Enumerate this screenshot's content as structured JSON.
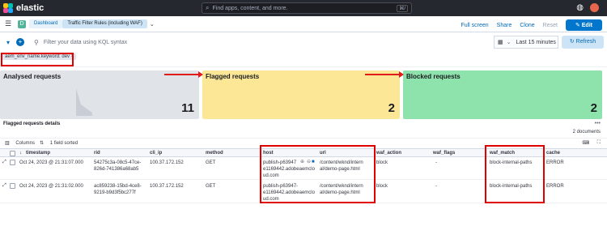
{
  "header": {
    "brand": "elastic",
    "search_placeholder": "Find apps, content, and more.",
    "search_shortcut": "⌘/"
  },
  "appbar": {
    "space_badge": "D",
    "breadcrumbs": [
      "Dashboard",
      "Traffic Filter Rules (including WAF)"
    ],
    "actions": [
      "Full screen",
      "Share",
      "Clone",
      "Reset"
    ],
    "edit_label": "Edit"
  },
  "querybar": {
    "placeholder": "Filter your data using KQL syntax",
    "time_range": "Last 15 minutes",
    "refresh_label": "Refresh"
  },
  "filter_pill": "aem_env_name.keyword: dev",
  "metrics": [
    {
      "title": "Analysed requests",
      "value": "11",
      "color": "#e0e3e8"
    },
    {
      "title": "Flagged requests",
      "value": "2",
      "color": "#fbe795"
    },
    {
      "title": "Blocked requests",
      "value": "2",
      "color": "#8ee3ac"
    }
  ],
  "table": {
    "title": "Flagged requests details",
    "doc_count": "2 documents",
    "columns_label": "Columns",
    "sort_label": "1 field sorted",
    "headers": [
      "timestamp",
      "rid",
      "cli_ip",
      "method",
      "host",
      "url",
      "waf_action",
      "waf_flags",
      "waf_match",
      "cache"
    ],
    "rows": [
      {
        "timestamp": "Oct 24, 2023 @ 21:31:07.000",
        "rid_1": "54275c3a-08c5-47ce-",
        "rid_2": "826d-741386a68ab5",
        "cli_ip": "100.37.172.152",
        "method": "GET",
        "host_1": "publish-p63947",
        "host_2": "e1169442.adobeaemclo",
        "host_3": "ud.com",
        "url_1": "/content/wknd/intern",
        "url_2": "al/demo-page.html",
        "waf_action": "block",
        "waf_flags": "-",
        "waf_match": "block-internal-paths",
        "cache": "ERROR"
      },
      {
        "timestamp": "Oct 24, 2023 @ 21:31:02.000",
        "rid_1": "ac859238-15bd-4ce8-",
        "rid_2": "9219-b9d3f5bc277f",
        "cli_ip": "100.37.172.152",
        "method": "GET",
        "host_1": "publish-p63947-",
        "host_2": "e1169442.adobeaemclo",
        "host_3": "ud.com",
        "url_1": "/content/wknd/intern",
        "url_2": "al/demo-page.html",
        "waf_action": "block",
        "waf_flags": "-",
        "waf_match": "block-internal-paths",
        "cache": "ERROR"
      }
    ]
  }
}
